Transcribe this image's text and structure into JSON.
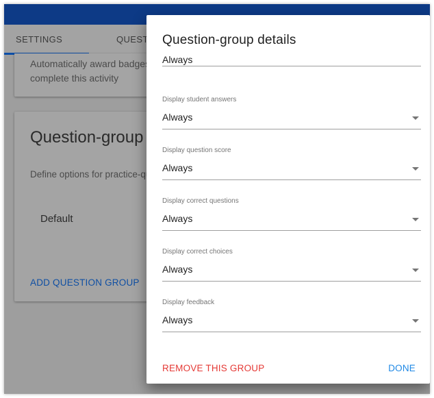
{
  "tabs": {
    "settings": "SETTINGS",
    "questions": "QUESTI"
  },
  "background": {
    "badges_text": "Automatically award badges for complete this activity",
    "section_title": "Question-group s",
    "section_desc": "Define options for practice-qu",
    "default_group": "Default",
    "add_group_label": "ADD QUESTION GROUP"
  },
  "dialog": {
    "title": "Question-group details",
    "partial_value": "Always",
    "fields": [
      {
        "label": "Display student answers",
        "value": "Always"
      },
      {
        "label": "Display question score",
        "value": "Always"
      },
      {
        "label": "Display correct questions",
        "value": "Always"
      },
      {
        "label": "Display correct choices",
        "value": "Always"
      },
      {
        "label": "Display feedback",
        "value": "Always"
      }
    ],
    "remove_label": "REMOVE THIS GROUP",
    "done_label": "DONE"
  },
  "colors": {
    "appbar": "#0d3a86",
    "accent_blue": "#1e88e5",
    "danger_red": "#e53935"
  },
  "icons": {
    "dropdown": "caret-down-icon"
  }
}
